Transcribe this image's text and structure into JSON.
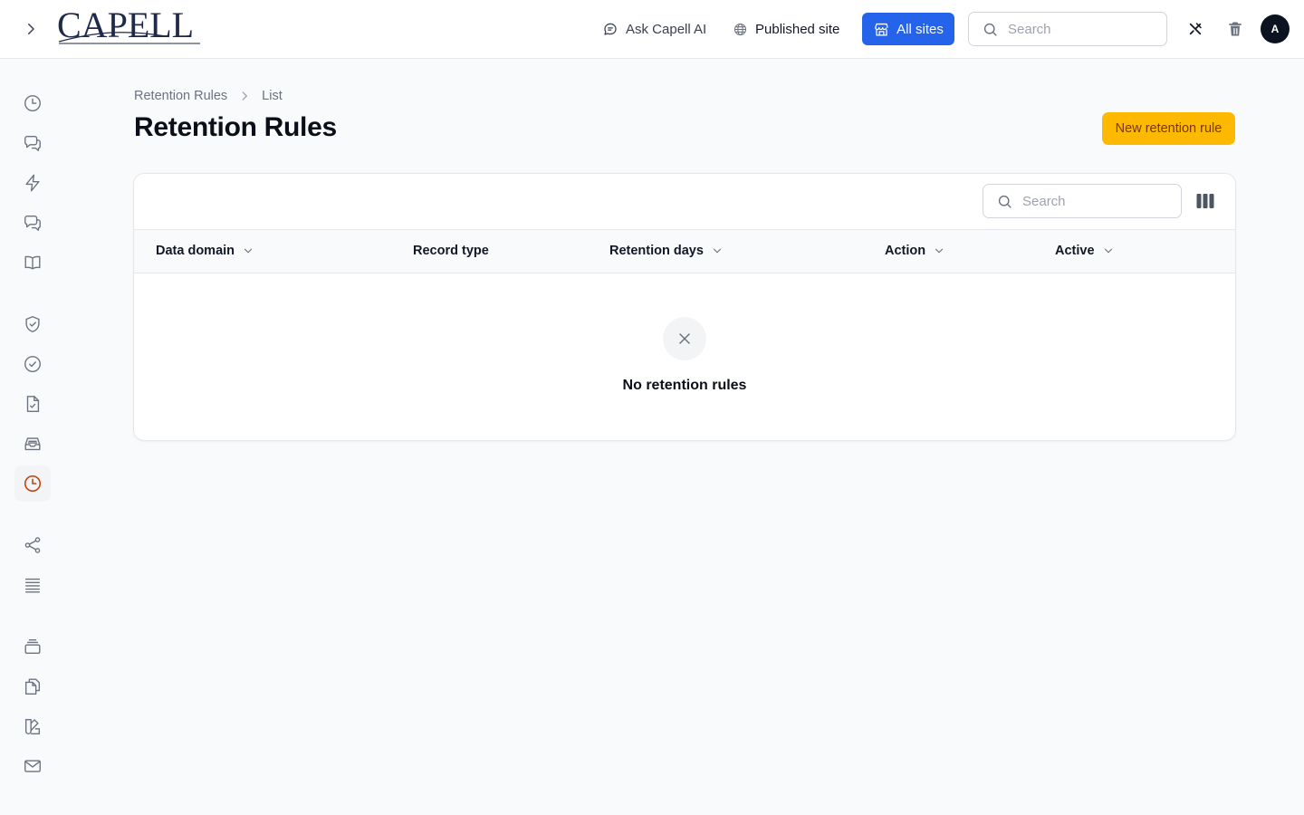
{
  "header": {
    "brand": "CAPELL",
    "ask_ai": "Ask Capell AI",
    "published_site": "Published site",
    "all_sites": "All sites",
    "search_placeholder": "Search",
    "avatar_initial": "A"
  },
  "sidebar": {
    "active_color": "#c2410c",
    "items": [
      {
        "icon": "clock-icon"
      },
      {
        "icon": "chat-bubbles-icon"
      },
      {
        "icon": "lightning-icon"
      },
      {
        "icon": "chat-bubbles-icon"
      },
      {
        "icon": "book-icon"
      },
      {
        "icon": "shield-check-icon"
      },
      {
        "icon": "check-circle-icon"
      },
      {
        "icon": "document-check-icon"
      },
      {
        "icon": "inbox-icon"
      },
      {
        "icon": "clock-icon",
        "active": true
      },
      {
        "icon": "share-icon"
      },
      {
        "icon": "list-icon"
      },
      {
        "icon": "stack-icon"
      },
      {
        "icon": "copy-icon"
      },
      {
        "icon": "swatch-icon"
      },
      {
        "icon": "envelope-icon"
      }
    ]
  },
  "breadcrumb": [
    "Retention Rules",
    "List"
  ],
  "page": {
    "title": "Retention Rules",
    "new_button": "New retention rule"
  },
  "table": {
    "search_placeholder": "Search",
    "columns": [
      {
        "label": "Data domain",
        "sortable": true
      },
      {
        "label": "Record type",
        "sortable": false
      },
      {
        "label": "Retention days",
        "sortable": true
      },
      {
        "label": "Action",
        "sortable": true
      },
      {
        "label": "Active",
        "sortable": true
      }
    ],
    "rows": [],
    "empty_text": "No retention rules"
  },
  "colors": {
    "primary": "#2563eb",
    "accent": "#fcb900"
  }
}
